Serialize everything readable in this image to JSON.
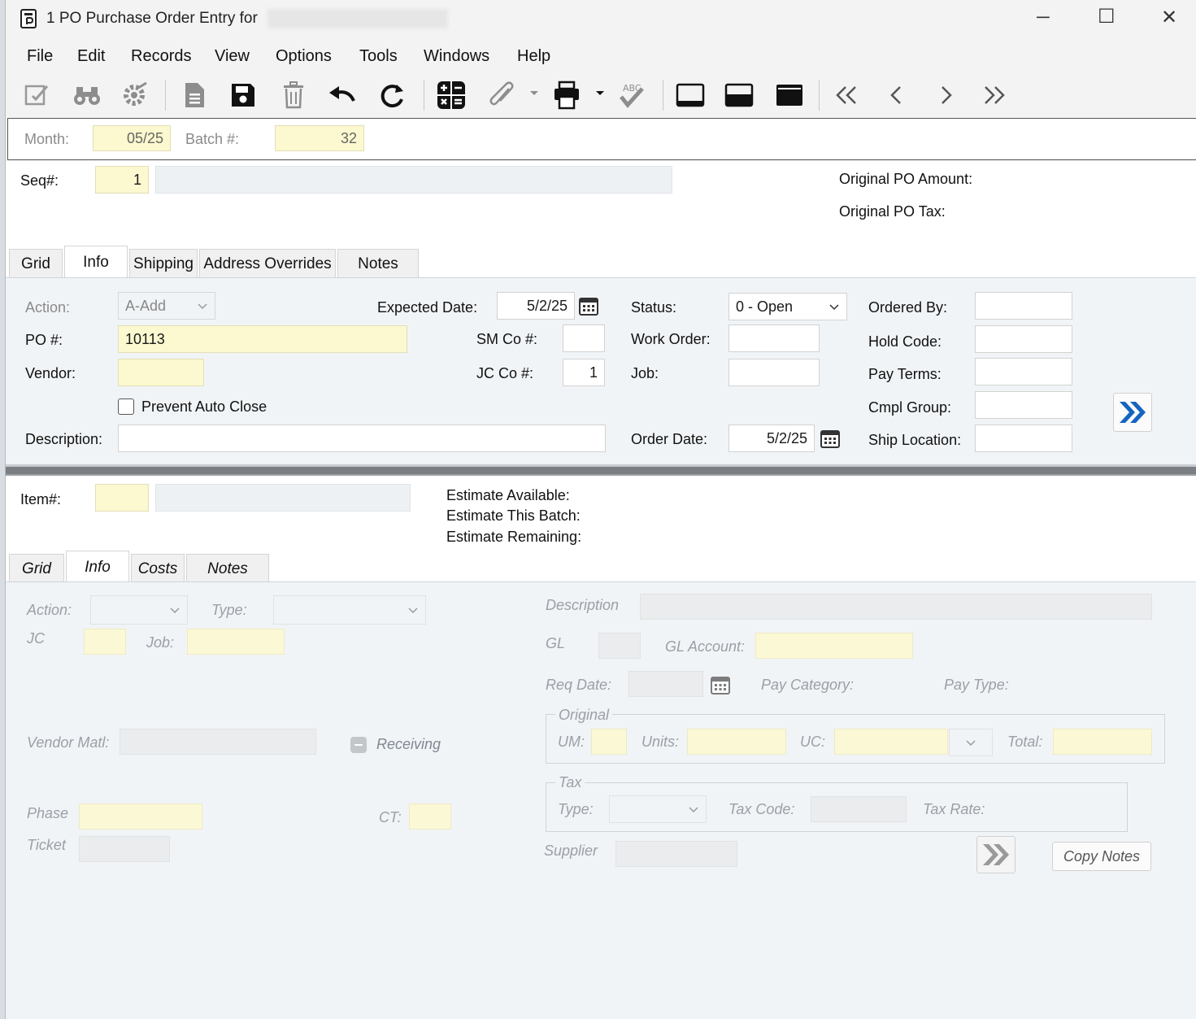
{
  "window": {
    "title": "1 PO Purchase Order Entry for",
    "minimize_label": "─",
    "maximize_label": "☐",
    "close_label": "✕"
  },
  "menu": [
    "File",
    "Edit",
    "Records",
    "View",
    "Options",
    "Tools",
    "Windows",
    "Help"
  ],
  "toolbar": {
    "icons": [
      "edit-icon",
      "binoculars-icon",
      "settings-gear-icon",
      "new-document-icon",
      "save-icon",
      "delete-icon",
      "undo-icon",
      "refresh-icon",
      "calculator-icon",
      "attachment-icon",
      "print-icon",
      "spellcheck-icon",
      "layout-top-icon",
      "layout-middle-icon",
      "layout-full-icon",
      "first-record-icon",
      "previous-record-icon",
      "next-record-icon",
      "last-record-icon"
    ],
    "spellcheck_text": "ABC"
  },
  "batch": {
    "month_label": "Month:",
    "month_value": "05/25",
    "batch_label": "Batch #:",
    "batch_value": "32"
  },
  "header": {
    "seq_label": "Seq#:",
    "seq_value": "1",
    "orig_amount_label": "Original PO Amount:",
    "orig_tax_label": "Original PO Tax:"
  },
  "header_tabs": [
    "Grid",
    "Info",
    "Shipping",
    "Address Overrides",
    "Notes"
  ],
  "header_active_tab": "Info",
  "po_info": {
    "action_label": "Action:",
    "action_value": "A-Add",
    "po_label": "PO #:",
    "po_value": "10113",
    "vendor_label": "Vendor:",
    "vendor_value": "",
    "prevent_auto_close_label": "Prevent Auto Close",
    "prevent_auto_close_checked": false,
    "description_label": "Description:",
    "description_value": "",
    "expected_date_label": "Expected Date:",
    "expected_date_value": "5/2/25",
    "sm_co_label": "SM Co #:",
    "sm_co_value": "",
    "jc_co_label": "JC Co #:",
    "jc_co_value": "1",
    "status_label": "Status:",
    "status_value": "0 - Open",
    "work_order_label": "Work Order:",
    "work_order_value": "",
    "job_label": "Job:",
    "job_value": "",
    "order_date_label": "Order Date:",
    "order_date_value": "5/2/25",
    "ordered_by_label": "Ordered By:",
    "hold_code_label": "Hold Code:",
    "pay_terms_label": "Pay Terms:",
    "cmpl_group_label": "Cmpl Group:",
    "ship_location_label": "Ship Location:"
  },
  "item": {
    "item_label": "Item#:",
    "item_value": "",
    "estimate_available_label": "Estimate Available:",
    "estimate_this_batch_label": "Estimate This Batch:",
    "estimate_remaining_label": "Estimate Remaining:"
  },
  "item_tabs": [
    "Grid",
    "Info",
    "Costs",
    "Notes"
  ],
  "item_active_tab": "Info",
  "item_info": {
    "action_label": "Action:",
    "type_label": "Type:",
    "jc_label": "JC",
    "job_label": "Job:",
    "vendor_matl_label": "Vendor Matl:",
    "receiving_label": "Receiving",
    "phase_label": "Phase",
    "ct_label": "CT:",
    "ticket_label": "Ticket",
    "description_label": "Description",
    "gl_label": "GL",
    "gl_account_label": "GL Account:",
    "req_date_label": "Req Date:",
    "pay_category_label": "Pay Category:",
    "pay_type_label": "Pay Type:",
    "original_group": "Original",
    "um_label": "UM:",
    "units_label": "Units:",
    "uc_label": "UC:",
    "total_label": "Total:",
    "tax_group": "Tax",
    "tax_type_label": "Type:",
    "tax_code_label": "Tax Code:",
    "tax_rate_label": "Tax Rate:",
    "supplier_label": "Supplier",
    "copy_notes_label": "Copy Notes"
  },
  "colors": {
    "required_field": "#fcf8cf",
    "panel_bg": "#f1f4f7",
    "accent_blue": "#1565c0"
  }
}
